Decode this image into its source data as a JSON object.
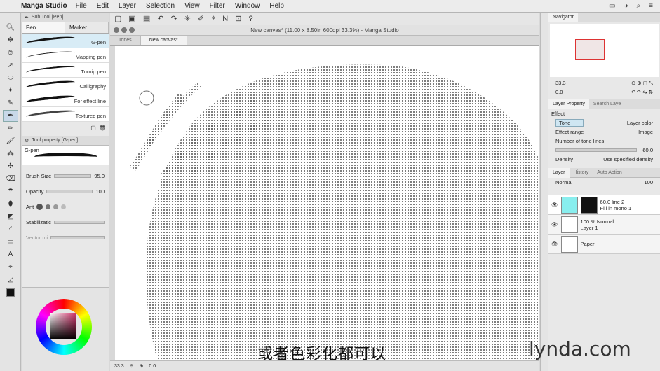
{
  "menubar": {
    "app_name": "Manga Studio",
    "items": [
      "File",
      "Edit",
      "Layer",
      "Selection",
      "View",
      "Filter",
      "Window",
      "Help"
    ]
  },
  "subtool": {
    "header": "Sub Tool [Pen]",
    "tabs": [
      "Pen",
      "Marker"
    ],
    "brushes": [
      "G-pen",
      "Mapping pen",
      "Turnip pen",
      "Calligraphy",
      "For effect line",
      "Textured pen"
    ]
  },
  "toolprop": {
    "header": "Tool property [G-pen]",
    "preview_label": "G-pen",
    "brush_size_label": "Brush Size",
    "brush_size_value": "95.0",
    "opacity_label": "Opacity",
    "opacity_value": "100",
    "ant_label": "Ant",
    "stabilization_label": "Stabilizatic",
    "vector_label": "Vector mi"
  },
  "document": {
    "title": "New canvas* (11.00 x 8.50in 600dpi 33.3%) - Manga Studio",
    "tabs": [
      "Tones",
      "New canvas*"
    ]
  },
  "status": {
    "zoom": "33.3",
    "angle": "0.0"
  },
  "navigator": {
    "tab": "Navigator",
    "zoom": "33.3",
    "angle": "0.0"
  },
  "layer_property": {
    "tabs": [
      "Layer Property",
      "Search Laye"
    ],
    "effect_label": "Effect",
    "tone_btn": "Tone",
    "layer_color_btn": "Layer color",
    "effect_range_label": "Effect range",
    "effect_range_value": "Image",
    "tone_lines_label": "Number of tone lines",
    "tone_lines_value": "60.0",
    "density_label": "Density",
    "density_value": "Use specified density"
  },
  "layers": {
    "tabs": [
      "Layer",
      "History",
      "Auto Action"
    ],
    "blend_mode": "Normal",
    "opacity": "100",
    "items": [
      {
        "line1": "60.0 line 2",
        "line2": "Fill in mono 1"
      },
      {
        "line1": "100 % Normal",
        "line2": "Layer 1"
      },
      {
        "line1": "",
        "line2": "Paper"
      }
    ]
  },
  "overlay": {
    "subtitle": "或者色彩化都可以",
    "watermark": "lynda.com"
  }
}
